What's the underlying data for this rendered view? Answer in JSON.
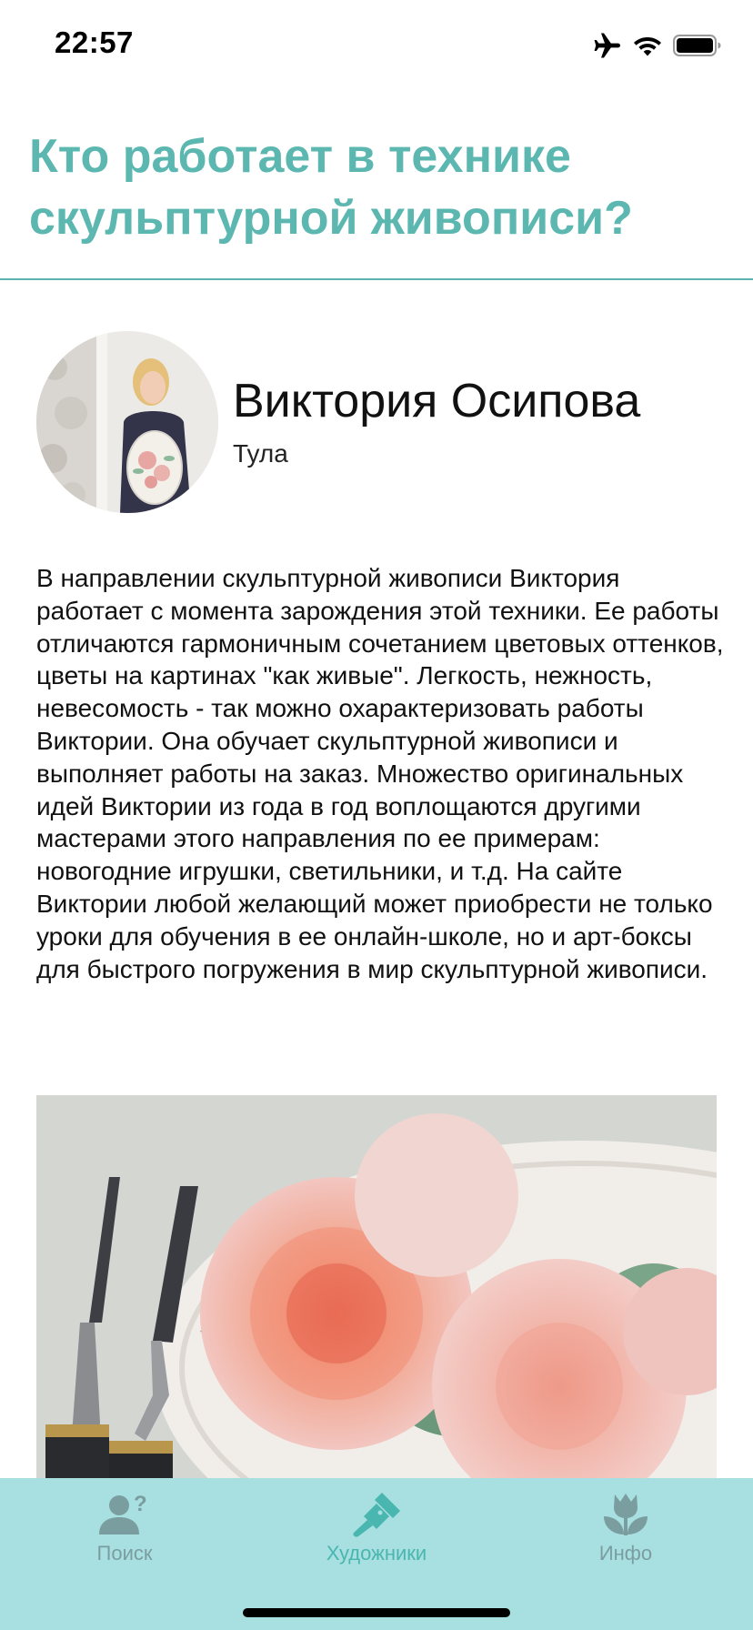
{
  "status_bar": {
    "time": "22:57",
    "icons": [
      "airplane-icon",
      "wifi-icon",
      "battery-icon"
    ]
  },
  "header": {
    "title": "Кто работает в технике скульптурной живописи?",
    "accent_color": "#5bb7b0"
  },
  "artist": {
    "name": "Виктория Осипова",
    "city": "Тула",
    "bio": "В направлении скульптурной живописи Виктория работает с момента зарождения этой техники. Ее работы отличаются гармоничным сочетанием цветовых оттенков, цветы на картинах \"как живые\". Легкость, нежность, невесомость - так можно охарактеризовать работы Виктории. Она обучает скульптурной живописи и выполняет работы на заказ. Множество оригинальных идей Виктории из года в год воплощаются другими мастерами этого направления по ее примерам: новогодние игрушки, светильники, и т.д. На сайте Виктории любой желающий может приобрести не только уроки для обучения в ее онлайн-школе, но и арт-боксы для быстрого погружения в мир скульптурной живописи."
  },
  "tab_bar": {
    "background": "#a8dfe0",
    "tabs": [
      {
        "label": "Поиск",
        "icon": "person-question-icon",
        "active": false
      },
      {
        "label": "Художники",
        "icon": "brush-icon",
        "active": true
      },
      {
        "label": "Инфо",
        "icon": "tulip-icon",
        "active": false
      }
    ]
  }
}
